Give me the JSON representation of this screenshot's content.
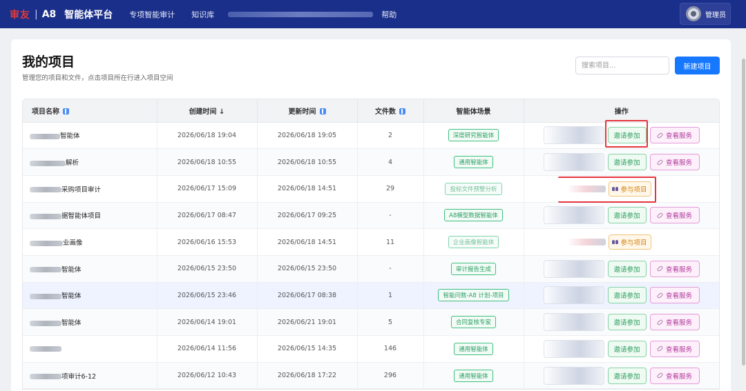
{
  "header": {
    "brand_logo": "审友",
    "brand_sep": "|",
    "brand_a8": "A8",
    "brand_title": "智能体平台",
    "nav": [
      "专项智能审计",
      "知识库"
    ],
    "help": "帮助",
    "user": "管理员"
  },
  "page": {
    "title": "我的项目",
    "subtitle": "管理您的项目和文件，点击项目所在行进入项目空间",
    "search_placeholder": "搜索项目...",
    "new_button": "新建项目"
  },
  "table": {
    "columns": [
      "项目名称",
      "创建时间 ↓",
      "更新时间",
      "文件数",
      "智能体场景",
      "操作"
    ],
    "invite_label": "邀请参加",
    "service_label": "查看服务",
    "join_label": "参与项目",
    "rows": [
      {
        "name": "智能体",
        "created": "2026/06/18 19:04",
        "updated": "2026/06/18 19:05",
        "files": "2",
        "scene": "深度研究智能体",
        "op": "invite"
      },
      {
        "name": "解析",
        "created": "2026/06/18 10:55",
        "updated": "2026/06/18 10:55",
        "files": "4",
        "scene": "通用智能体",
        "op": "invite"
      },
      {
        "name": "采购项目审计",
        "created": "2026/06/17 15:09",
        "updated": "2026/06/18 14:51",
        "files": "29",
        "scene": "投标文件预警分析",
        "op": "join"
      },
      {
        "name": "据智能体项目",
        "created": "2026/06/17 08:47",
        "updated": "2026/06/17 09:25",
        "files": "-",
        "scene": "A8模型数据智能体",
        "op": "invite"
      },
      {
        "name": "业画像",
        "created": "2026/06/16 15:53",
        "updated": "2026/06/18 14:51",
        "files": "11",
        "scene": "企业画像智能体",
        "op": "join"
      },
      {
        "name": "智能体",
        "created": "2026/06/15 23:50",
        "updated": "2026/06/15 23:50",
        "files": "-",
        "scene": "审计报告生成",
        "op": "invite"
      },
      {
        "name": "智能体",
        "created": "2026/06/15 23:46",
        "updated": "2026/06/17 08:38",
        "files": "1",
        "scene": "智能问数-A8 计划-项目",
        "op": "invite"
      },
      {
        "name": "智能体",
        "created": "2026/06/14 19:01",
        "updated": "2026/06/21 19:01",
        "files": "5",
        "scene": "合同复核专家",
        "op": "invite"
      },
      {
        "name": "",
        "created": "2026/06/14 11:56",
        "updated": "2026/06/15 14:35",
        "files": "146",
        "scene": "通用智能体",
        "op": "invite"
      },
      {
        "name": "项审计6-12",
        "created": "2026/06/12 10:43",
        "updated": "2026/06/18 17:22",
        "files": "296",
        "scene": "通用智能体",
        "op": "invite"
      }
    ]
  }
}
